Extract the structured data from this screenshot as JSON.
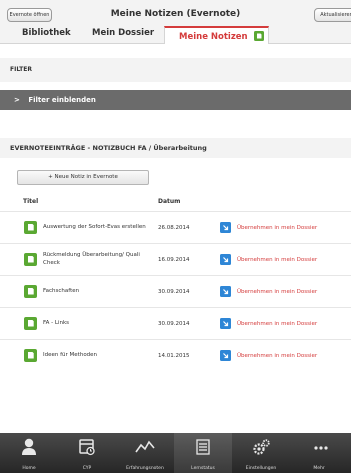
{
  "header": {
    "back_label": "Evernote öffnen",
    "title": "Meine Notizen (Evernote)",
    "refresh_label": "Aktualisieren"
  },
  "tabs": [
    {
      "label": "Bibliothek",
      "active": false
    },
    {
      "label": "Mein Dossier",
      "active": false
    },
    {
      "label": "Meine Notizen",
      "active": true
    }
  ],
  "filter": {
    "heading": "FILTER",
    "toggle_label": "Filter einblenden"
  },
  "section": {
    "heading": "EVERNOTEEINTRÄGE - NOTIZBUCH FA / Überarbeitung",
    "new_note_label": "+ Neue Notiz in Evernote"
  },
  "table": {
    "columns": [
      "Titel",
      "Datum"
    ],
    "rows": [
      {
        "title": "Auswertung der Sofort-Evas erstellen",
        "date": "26.08.2014",
        "action": "Übernehmen in mein Dossier"
      },
      {
        "title": "Rückmeldung Überarbeitung/ Quali Check",
        "date": "16.09.2014",
        "action": "Übernehmen in mein Dossier"
      },
      {
        "title": "Fachschaften",
        "date": "30.09.2014",
        "action": "Übernehmen in mein Dossier"
      },
      {
        "title": "FA - Links",
        "date": "30.09.2014",
        "action": "Übernehmen in mein Dossier"
      },
      {
        "title": "Ideen für Methoden",
        "date": "14.01.2015",
        "action": "Übernehmen in mein Dossier"
      }
    ]
  },
  "bottom_nav": [
    {
      "label": "Home",
      "icon": "person-icon"
    },
    {
      "label": "CYP",
      "icon": "calendar-icon"
    },
    {
      "label": "Erfahrungsnoten",
      "icon": "chart-line-icon"
    },
    {
      "label": "Lernstatus",
      "icon": "list-icon",
      "active": true
    },
    {
      "label": "Einstellungen",
      "icon": "gears-icon"
    },
    {
      "label": "Mehr",
      "icon": "more-icon"
    }
  ],
  "colors": {
    "accent": "#d43b3b",
    "evernote_green": "#5aa832",
    "action_blue": "#2e86d6",
    "filter_bar": "#6b6b6b",
    "bottom_bar": "#2f2f2f"
  }
}
